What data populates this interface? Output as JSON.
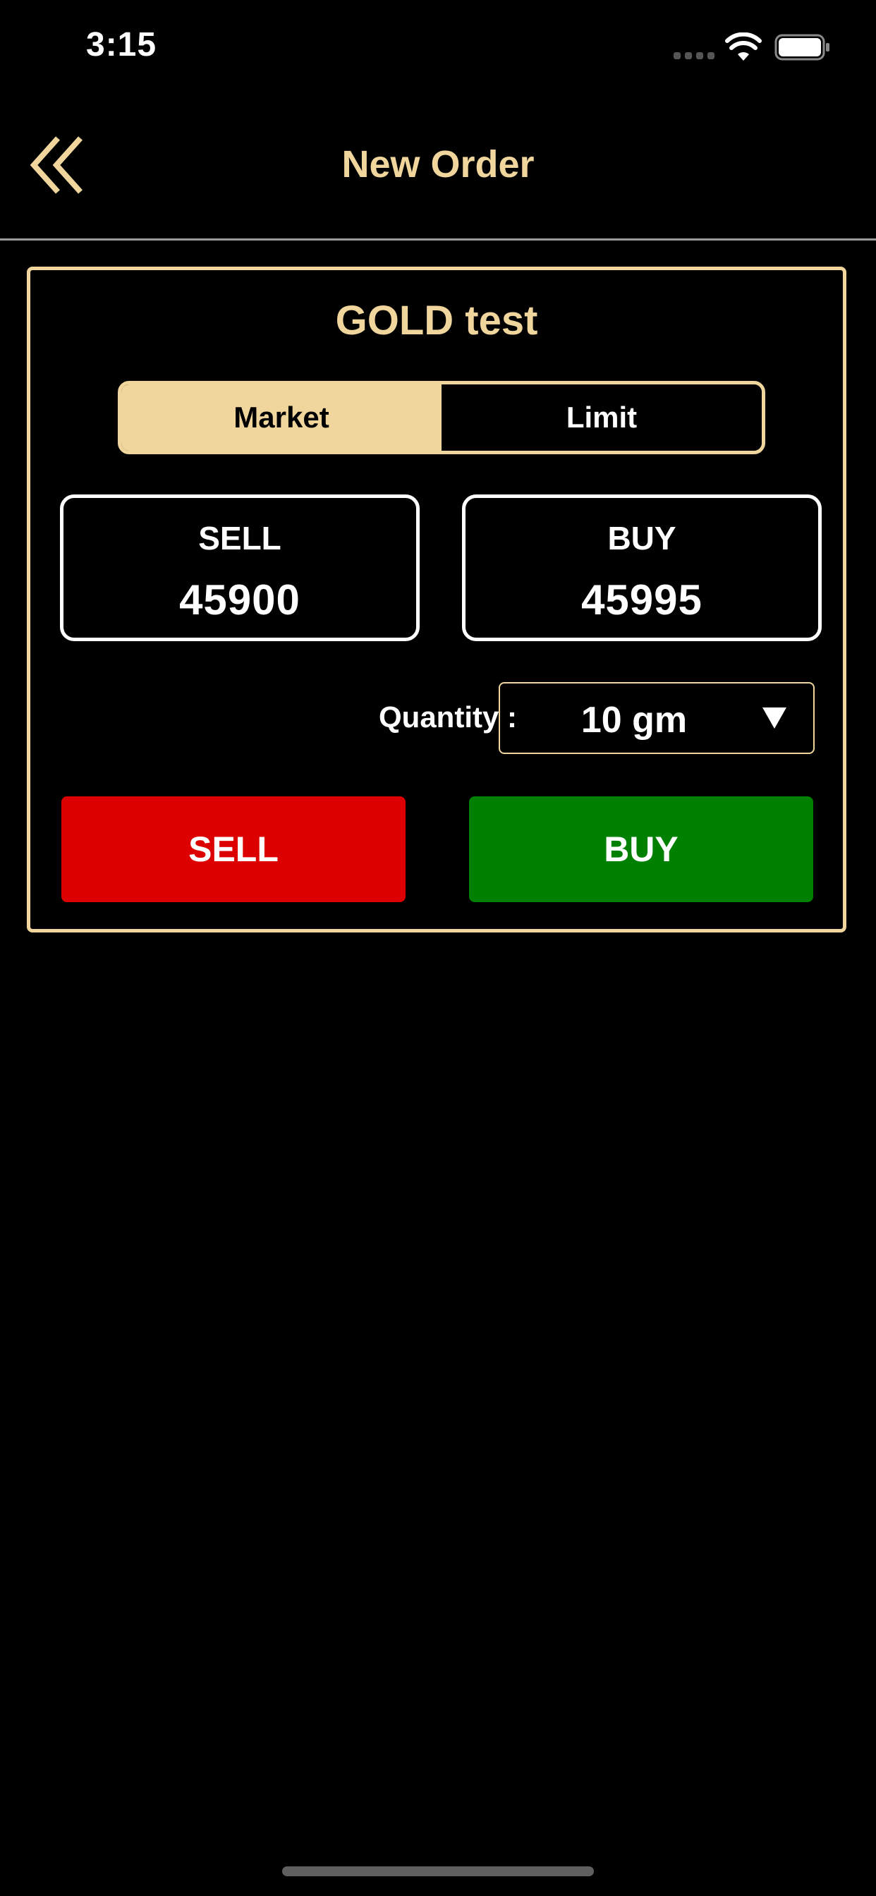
{
  "status_bar": {
    "time": "3:15"
  },
  "header": {
    "title": "New Order",
    "back_icon": "double-chevron-left-icon"
  },
  "order": {
    "instrument": "GOLD test",
    "order_types": [
      {
        "label": "Market",
        "selected": true
      },
      {
        "label": "Limit",
        "selected": false
      }
    ],
    "prices": {
      "sell": {
        "label": "SELL",
        "value": "45900"
      },
      "buy": {
        "label": "BUY",
        "value": "45995"
      }
    },
    "quantity": {
      "label": "Quantity :",
      "value": "10 gm"
    },
    "actions": {
      "sell_label": "SELL",
      "buy_label": "BUY"
    }
  },
  "colors": {
    "accent_gold": "#f0d59c",
    "sell_red": "#dc0000",
    "buy_green": "#008000",
    "background": "#000000"
  }
}
